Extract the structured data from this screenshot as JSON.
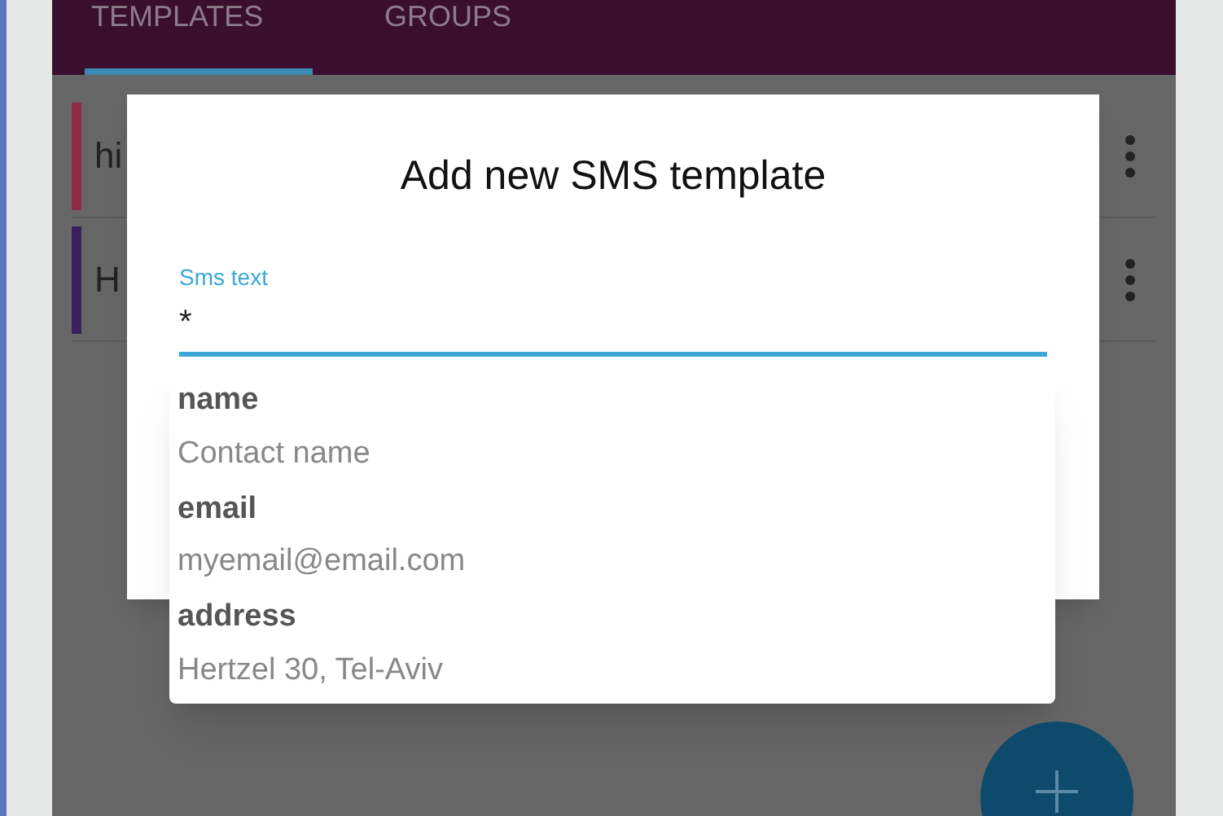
{
  "tabs": [
    {
      "label": "TEMPLATES",
      "selected": true
    },
    {
      "label": "GROUPS",
      "selected": false
    }
  ],
  "templates": [
    {
      "text": "hi",
      "color": "#8e2a44"
    },
    {
      "text": "H",
      "color": "#3b1f5e"
    }
  ],
  "dialog": {
    "title": "Add new SMS template",
    "field": {
      "label": "Sms text",
      "value": "*"
    }
  },
  "suggestions": [
    {
      "key": "name",
      "example": "Contact name"
    },
    {
      "key": "email",
      "example": "myemail@email.com"
    },
    {
      "key": "address",
      "example": "Hertzel 30, Tel-Aviv"
    }
  ]
}
